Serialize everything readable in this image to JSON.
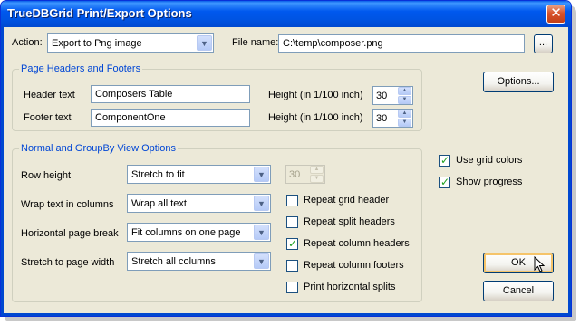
{
  "window": {
    "title": "TrueDBGrid Print/Export Options",
    "close_glyph": "✕"
  },
  "top": {
    "action_label": "Action:",
    "action_value": "Export to Png image",
    "filename_label": "File name:",
    "filename_value": "C:\\temp\\composer.png",
    "browse_label": "..."
  },
  "headers_group": {
    "title": "Page Headers and Footers",
    "header_label": "Header text",
    "header_value": "Composers Table",
    "footer_label": "Footer text",
    "footer_value": "ComponentOne",
    "header_height_label": "Height (in 1/100 inch)",
    "header_height_value": "30",
    "footer_height_label": "Height (in 1/100 inch)",
    "footer_height_value": "30"
  },
  "options_button": "Options...",
  "view_group": {
    "title": "Normal and GroupBy View Options",
    "row_height_label": "Row height",
    "row_height_value": "Stretch to fit",
    "row_height_number": "30",
    "wrap_label": "Wrap text in columns",
    "wrap_value": "Wrap all text",
    "hbreak_label": "Horizontal page break",
    "hbreak_value": "Fit columns on one page",
    "stretch_label": "Stretch to page width",
    "stretch_value": "Stretch all columns",
    "checks": [
      {
        "label": "Repeat grid header",
        "checked": false
      },
      {
        "label": "Repeat split headers",
        "checked": false
      },
      {
        "label": "Repeat column headers",
        "checked": true
      },
      {
        "label": "Repeat column footers",
        "checked": false
      },
      {
        "label": "Print horizontal splits",
        "checked": false
      }
    ]
  },
  "side_checks": [
    {
      "label": "Use grid colors",
      "checked": true
    },
    {
      "label": "Show progress",
      "checked": true
    }
  ],
  "buttons": {
    "ok": "OK",
    "cancel": "Cancel"
  },
  "check_glyph": "✓",
  "arrow_glyph": "▼",
  "spin_up_glyph": "▲",
  "spin_down_glyph": "▼"
}
